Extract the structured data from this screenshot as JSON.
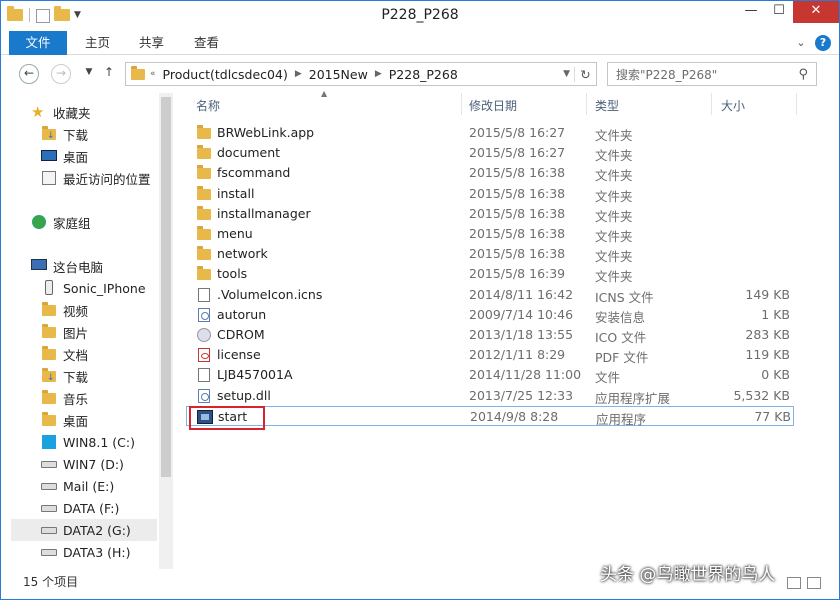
{
  "window": {
    "title": "P228_P268"
  },
  "ribbon": {
    "tabs": [
      "文件",
      "主页",
      "共享",
      "查看"
    ],
    "help": "?"
  },
  "address": {
    "prefix": "«",
    "crumbs": [
      "Product(tdlcsdec04)",
      "2015New",
      "P228_P268"
    ],
    "search_placeholder": "搜索\"P228_P268\""
  },
  "nav": {
    "favorites": {
      "label": "收藏夹",
      "items": [
        "下载",
        "桌面",
        "最近访问的位置"
      ]
    },
    "homegroup": {
      "label": "家庭组"
    },
    "thispc": {
      "label": "这台电脑",
      "items": [
        "Sonic_IPhone",
        "视频",
        "图片",
        "文档",
        "下载",
        "音乐",
        "桌面",
        "WIN8.1 (C:)",
        "WIN7 (D:)",
        "Mail (E:)",
        "DATA (F:)",
        "DATA2 (G:)",
        "DATA3 (H:)"
      ]
    }
  },
  "columns": {
    "name": "名称",
    "date": "修改日期",
    "type": "类型",
    "size": "大小"
  },
  "files": [
    {
      "name": "BRWebLink.app",
      "date": "2015/5/8 16:27",
      "type": "文件夹",
      "size": "",
      "icon": "folder-icon"
    },
    {
      "name": "document",
      "date": "2015/5/8 16:27",
      "type": "文件夹",
      "size": "",
      "icon": "folder-icon"
    },
    {
      "name": "fscommand",
      "date": "2015/5/8 16:38",
      "type": "文件夹",
      "size": "",
      "icon": "folder-icon"
    },
    {
      "name": "install",
      "date": "2015/5/8 16:38",
      "type": "文件夹",
      "size": "",
      "icon": "folder-icon"
    },
    {
      "name": "installmanager",
      "date": "2015/5/8 16:38",
      "type": "文件夹",
      "size": "",
      "icon": "folder-icon"
    },
    {
      "name": "menu",
      "date": "2015/5/8 16:38",
      "type": "文件夹",
      "size": "",
      "icon": "folder-icon"
    },
    {
      "name": "network",
      "date": "2015/5/8 16:38",
      "type": "文件夹",
      "size": "",
      "icon": "folder-icon"
    },
    {
      "name": "tools",
      "date": "2015/5/8 16:39",
      "type": "文件夹",
      "size": "",
      "icon": "folder-icon"
    },
    {
      "name": ".VolumeIcon.icns",
      "date": "2014/8/11 16:42",
      "type": "ICNS 文件",
      "size": "149 KB",
      "icon": "file-icon"
    },
    {
      "name": "autorun",
      "date": "2009/7/14 10:46",
      "type": "安装信息",
      "size": "1 KB",
      "icon": "setup-info-icon"
    },
    {
      "name": "CDROM",
      "date": "2013/1/18 13:55",
      "type": "ICO 文件",
      "size": "283 KB",
      "icon": "cd-icon"
    },
    {
      "name": "license",
      "date": "2012/1/11 8:29",
      "type": "PDF 文件",
      "size": "119 KB",
      "icon": "pdf-icon"
    },
    {
      "name": "LJB457001A",
      "date": "2014/11/28 11:00",
      "type": "文件",
      "size": "0 KB",
      "icon": "file-icon"
    },
    {
      "name": "setup.dll",
      "date": "2013/7/25 12:33",
      "type": "应用程序扩展",
      "size": "5,532 KB",
      "icon": "dll-icon"
    },
    {
      "name": "start",
      "date": "2014/9/8 8:28",
      "type": "应用程序",
      "size": "77 KB",
      "icon": "app-icon"
    }
  ],
  "status": {
    "count": "15 个项目"
  },
  "watermark": "头条 @鸟瞰世界的鸟人",
  "colors": {
    "accent": "#1979ca",
    "highlight": "#d9232d",
    "close": "#c7372f"
  }
}
